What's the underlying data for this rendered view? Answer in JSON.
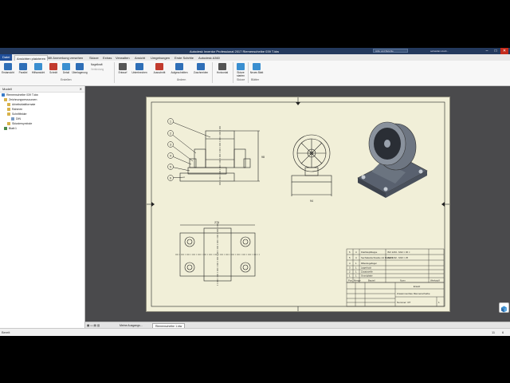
{
  "window": {
    "title": "Autodesk Inventor Professional 2017   Riemenscheibe 039 T.idw",
    "search_placeholder": "Hilfe und Befehle durchsuchen",
    "user": "sebastian.stock...",
    "controls": [
      "–",
      "□",
      "✕"
    ]
  },
  "ribbon_tabs": [
    "Datei",
    "Ansichten platzieren",
    "Mit Anmerkung versehen",
    "Skizze",
    "Extras",
    "Verwalten",
    "Ansicht",
    "Umgebungen",
    "Erste Schritte",
    "Autodesk A360"
  ],
  "ribbon": {
    "buttons": [
      {
        "label": "Erstansicht",
        "color": "#2f6fb7"
      },
      {
        "label": "Parallel",
        "color": "#2f6fb7"
      },
      {
        "label": "Hilfsansicht",
        "color": "#3a8fd0"
      },
      {
        "label": "Schnitt",
        "color": "#c23b2e"
      },
      {
        "label": "Detail",
        "color": "#3a8fd0"
      },
      {
        "label": "Überlagerung",
        "color": "#2f6fb7"
      },
      {
        "label": "Entwurf",
        "color": "#555555"
      },
      {
        "label": "Unterbrechen",
        "color": "#2f6fb7"
      },
      {
        "label": "Ausschnitt",
        "color": "#c23b2e"
      },
      {
        "label": "Aufgeschnitten",
        "color": "#2f6fb7"
      },
      {
        "label": "Zuschneiden",
        "color": "#2f6fb7"
      },
      {
        "label": "Horizontal",
        "color": "#555555"
      },
      {
        "label": "Skizze starten",
        "color": "#3a8fd0"
      },
      {
        "label": "Neues Blatt",
        "color": "#3a8fd0"
      }
    ],
    "small_items": [
      "Nagelkraft",
      "Verbindung"
    ],
    "groups": [
      "Erstellen",
      "Ändern",
      "Skizze",
      "Blätter"
    ]
  },
  "browser": {
    "title": "Modell",
    "close": "✕",
    "tree": [
      "Riemenscheibe 039 T.idw",
      "Zeichnungsressourcen",
      "Arbeitsblattformate",
      "Rahmen",
      "Schriftfelder",
      "DIN",
      "Skizziersymbole",
      "Blatt:1"
    ]
  },
  "drawing": {
    "balloons": [
      "1",
      "2",
      "3",
      "4",
      "5",
      "6"
    ],
    "dims": [
      "98",
      "94",
      "276",
      "110"
    ],
    "parts_list": [
      [
        "6",
        "4",
        "Flachkopfklappe",
        "ISO 1234 - M12 × 30 ×"
      ],
      [
        "5",
        "4",
        "Sechskantschraube mit Flansch",
        "ISO 4162 - M10 × 25"
      ],
      [
        "4",
        "1",
        "Rillenkugellager"
      ],
      [
        "3",
        "1",
        "Lagerbock"
      ],
      [
        "2",
        "1",
        "Zusatzwelle"
      ],
      [
        "1",
        "1",
        "Grundplatte"
      ]
    ],
    "parts_list_header": [
      "Pos.",
      "Menge",
      "Bauteil",
      "Norm",
      "Werkstoff"
    ],
    "title_block": {
      "company": "Ersatz",
      "title": "Zusammenbau Riemenscheibe",
      "number": "Nummer: 3/7",
      "sheet": "1"
    }
  },
  "doc_tabs": [
    "Meine Ausgangs...",
    "Riemenscheibe 1.idw"
  ],
  "status": {
    "left": "Bereit",
    "right1": "11",
    "right2": "6"
  }
}
